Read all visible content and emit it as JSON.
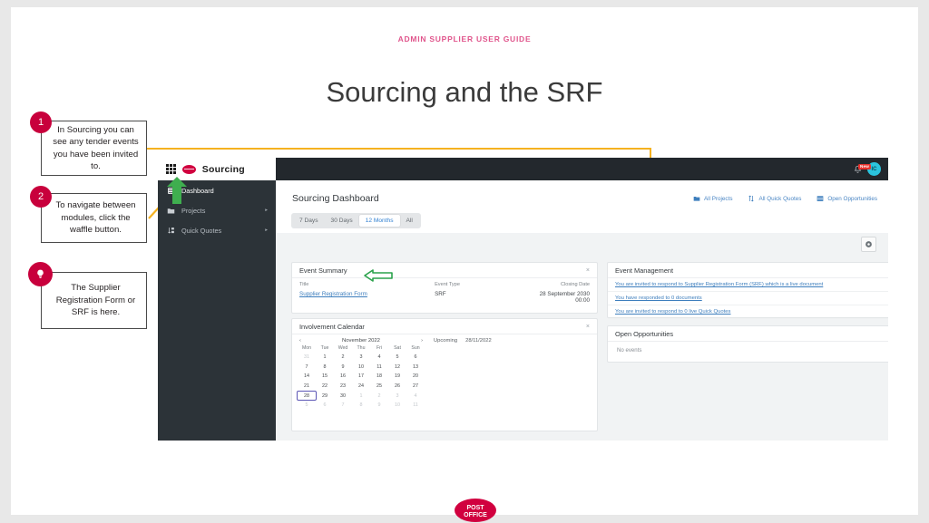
{
  "slide": {
    "kicker": "ADMIN SUPPLIER USER GUIDE",
    "title": "Sourcing and the SRF",
    "footer_logo_line1": "POST",
    "footer_logo_line2": "OFFICE"
  },
  "callouts": [
    {
      "badge": "1",
      "text": "In Sourcing you can see any tender events you have been invited to."
    },
    {
      "badge": "2",
      "text": "To navigate between modules, click the waffle button."
    },
    {
      "badge": "bulb-icon",
      "text": "The Supplier Registration Form or SRF is here."
    }
  ],
  "app": {
    "topbar": {
      "brand": "Sourcing",
      "waffle_icon": "waffle-icon",
      "logo_icon": "post-office-logo-icon",
      "bell_icon": "bell-icon",
      "bell_badge": "New",
      "avatar_initials": "IC"
    },
    "sidebar": [
      {
        "label": "Dashboard",
        "icon": "dashboard-icon",
        "active": true,
        "chevron": ""
      },
      {
        "label": "Projects",
        "icon": "folder-icon",
        "active": false,
        "chevron": "▸"
      },
      {
        "label": "Quick Quotes",
        "icon": "quick-quotes-icon",
        "active": false,
        "chevron": "▸"
      }
    ],
    "header": {
      "title": "Sourcing Dashboard",
      "range_filters": [
        {
          "label": "7 Days",
          "active": false
        },
        {
          "label": "30 Days",
          "active": false
        },
        {
          "label": "12 Months",
          "active": true
        },
        {
          "label": "All",
          "active": false
        }
      ],
      "top_links": [
        {
          "label": "All Projects",
          "icon": "folder-icon"
        },
        {
          "label": "All Quick Quotes",
          "icon": "sort-arrows-icon"
        },
        {
          "label": "Open Opportunities",
          "icon": "calendar-grid-icon"
        }
      ],
      "settings_icon": "gear-icon"
    },
    "event_summary": {
      "title": "Event Summary",
      "close_icon": "×",
      "columns": [
        "Title",
        "Event Type",
        "Closing Date"
      ],
      "rows": [
        {
          "title": "Supplier Registration Form",
          "event_type": "SRF",
          "closing_date": "28 September 2030 00:00"
        }
      ]
    },
    "involvement_calendar": {
      "title": "Involvement Calendar",
      "close_icon": "×",
      "prev_icon": "‹",
      "next_icon": "›",
      "month_label": "November 2022",
      "day_names": [
        "Mon",
        "Tue",
        "Wed",
        "Thu",
        "Fri",
        "Sat",
        "Sun"
      ],
      "weeks": [
        [
          {
            "d": "31",
            "mut": true
          },
          {
            "d": "1"
          },
          {
            "d": "2"
          },
          {
            "d": "3"
          },
          {
            "d": "4"
          },
          {
            "d": "5"
          },
          {
            "d": "6"
          }
        ],
        [
          {
            "d": "7"
          },
          {
            "d": "8"
          },
          {
            "d": "9"
          },
          {
            "d": "10"
          },
          {
            "d": "11"
          },
          {
            "d": "12"
          },
          {
            "d": "13"
          }
        ],
        [
          {
            "d": "14"
          },
          {
            "d": "15"
          },
          {
            "d": "16"
          },
          {
            "d": "17"
          },
          {
            "d": "18"
          },
          {
            "d": "19"
          },
          {
            "d": "20"
          }
        ],
        [
          {
            "d": "21"
          },
          {
            "d": "22"
          },
          {
            "d": "23"
          },
          {
            "d": "24"
          },
          {
            "d": "25"
          },
          {
            "d": "26"
          },
          {
            "d": "27"
          }
        ],
        [
          {
            "d": "28",
            "sel": true
          },
          {
            "d": "29"
          },
          {
            "d": "30"
          },
          {
            "d": "1",
            "mut": true
          },
          {
            "d": "2",
            "mut": true
          },
          {
            "d": "3",
            "mut": true
          },
          {
            "d": "4",
            "mut": true
          }
        ],
        [
          {
            "d": "5",
            "mut": true
          },
          {
            "d": "6",
            "mut": true
          },
          {
            "d": "7",
            "mut": true
          },
          {
            "d": "8",
            "mut": true
          },
          {
            "d": "9",
            "mut": true
          },
          {
            "d": "10",
            "mut": true
          },
          {
            "d": "11",
            "mut": true
          }
        ]
      ],
      "upcoming_label": "Upcoming",
      "upcoming_date": "28/11/2022"
    },
    "event_management": {
      "title": "Event Management",
      "close_icon": "×",
      "links": [
        "You are invited to respond to Supplier Registration Form (SRF) which is a live document",
        "You have responded to 0 documents",
        "You are invited to respond to 0 live Quick Quotes"
      ]
    },
    "open_opportunities": {
      "title": "Open Opportunities",
      "close_icon": "×",
      "empty_text": "No events"
    }
  },
  "colors": {
    "brand_red": "#c8003c",
    "callout_line": "#f5b220",
    "highlight_arrow": "#2aa24b",
    "link_blue": "#3d7ebd",
    "sidebar_bg": "#2c3338",
    "topbar_bg": "#23282d"
  }
}
